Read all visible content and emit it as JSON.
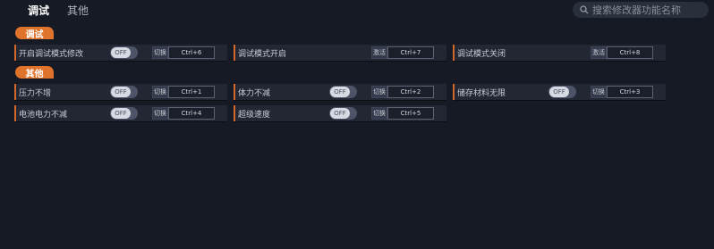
{
  "tabs": [
    {
      "label": "调试"
    },
    {
      "label": "其他"
    }
  ],
  "search": {
    "placeholder": "搜索修改器功能名称"
  },
  "sections": {
    "debug": "调试",
    "other": "其他"
  },
  "toggle_state": "OFF",
  "rows": {
    "enable_debug_mod": {
      "label": "开启调试模式修改",
      "action": "切换",
      "hotkey": "Ctrl+6"
    },
    "debug_on": {
      "label": "调试模式开启",
      "action": "激活",
      "hotkey": "Ctrl+7"
    },
    "debug_off": {
      "label": "调试模式关闭",
      "action": "激活",
      "hotkey": "Ctrl+8"
    },
    "no_pressure_increase": {
      "label": "压力不增",
      "action": "切换",
      "hotkey": "Ctrl+1"
    },
    "stamina_no_decrease": {
      "label": "体力不减",
      "action": "切换",
      "hotkey": "Ctrl+2"
    },
    "unlimited_storage": {
      "label": "储存材料无限",
      "action": "切换",
      "hotkey": "Ctrl+3"
    },
    "battery_no_decrease": {
      "label": "电池电力不减",
      "action": "切换",
      "hotkey": "Ctrl+4"
    },
    "super_speed": {
      "label": "超级速度",
      "action": "切换",
      "hotkey": "Ctrl+5"
    }
  }
}
